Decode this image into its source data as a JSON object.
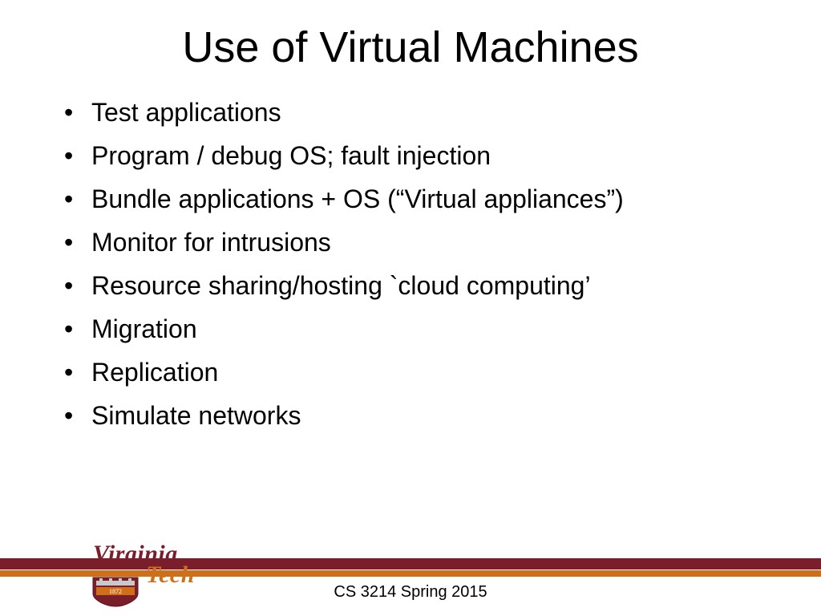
{
  "title": "Use of Virtual Machines",
  "bullets": [
    "Test applications",
    "Program / debug OS; fault injection",
    "Bundle applications + OS (“Virtual appliances”)",
    "Monitor for intrusions",
    "Resource sharing/hosting `cloud computing’",
    "Migration",
    "Replication",
    "Simulate networks"
  ],
  "footer": "CS 3214 Spring 2015",
  "logo": {
    "line1": "Virginia",
    "line2": "Tech",
    "year": "1872"
  },
  "colors": {
    "maroon": "#7a1e2b",
    "orange": "#d06f1a"
  }
}
